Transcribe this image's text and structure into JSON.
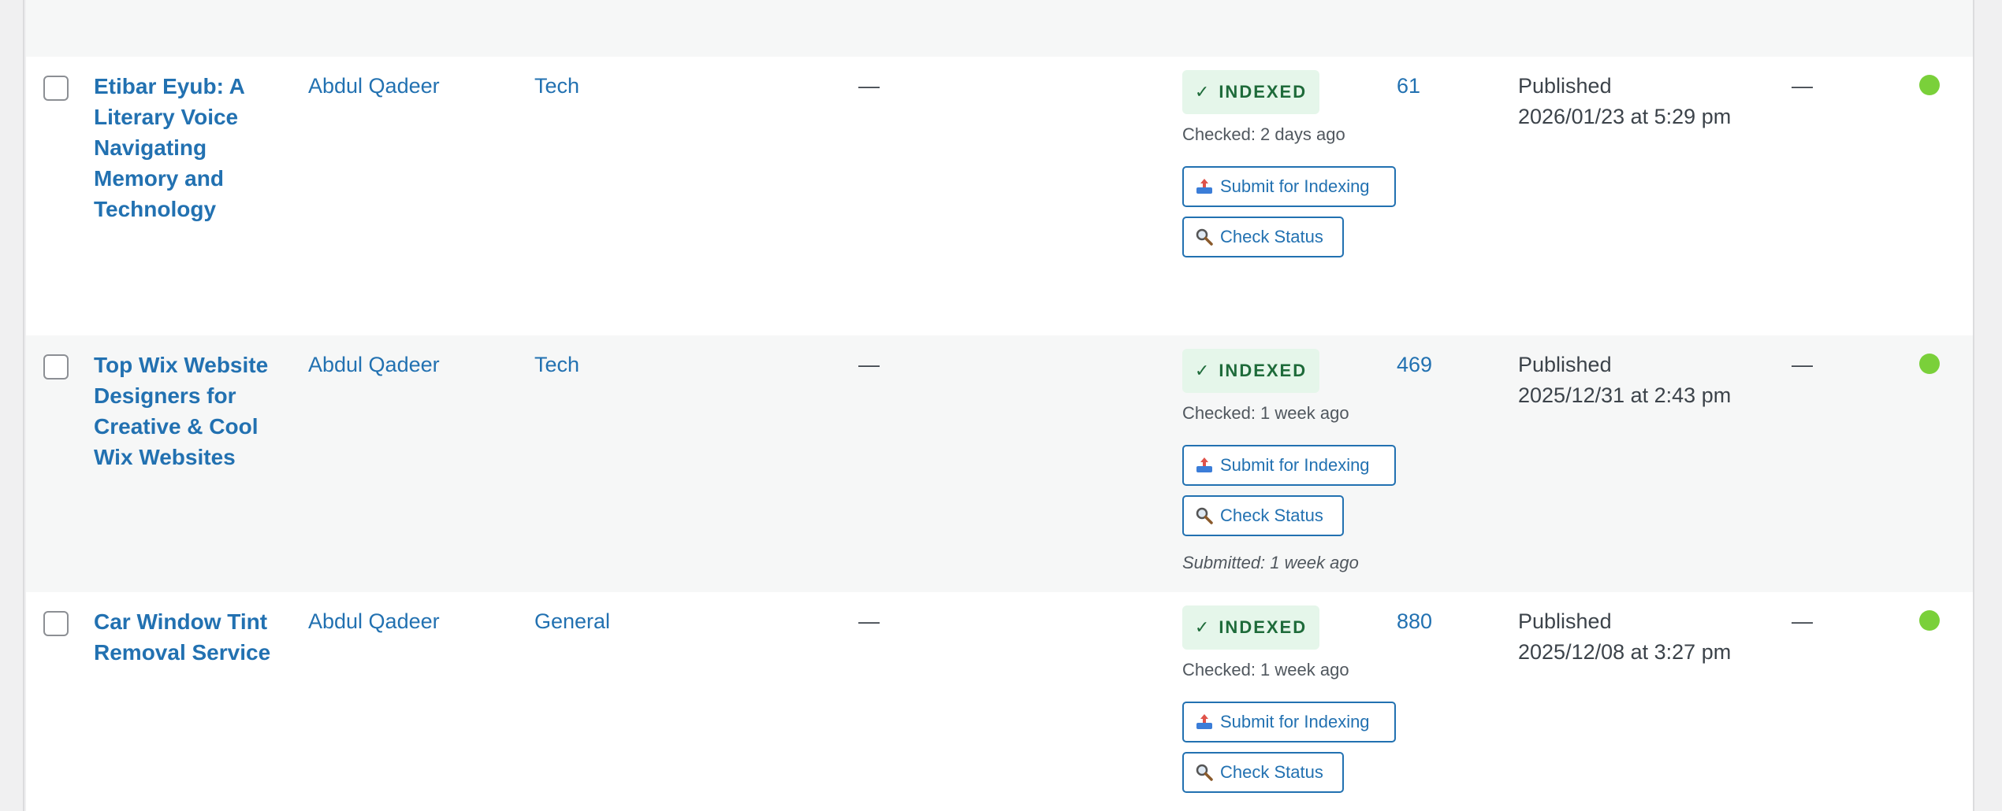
{
  "colors": {
    "link": "#2271b1",
    "badge_bg": "#e5f6ea",
    "badge_text": "#1e6b3a",
    "status_dot": "#7ad03a"
  },
  "icons": {
    "submit": "upload-tray-icon",
    "check": "magnifier-icon"
  },
  "rows": [
    {
      "title": "Etibar Eyub: A Literary Voice Navigating Memory and Technology",
      "author": "Abdul Qadeer",
      "category": "Tech",
      "tags": "—",
      "index_status": "INDEXED",
      "checked": "Checked: 2 days ago",
      "submit_label": "Submit for Indexing",
      "check_label": "Check Status",
      "submitted": "",
      "count": "61",
      "date_status": "Published",
      "date": "2026/01/23 at 5:29 pm",
      "extra": "—"
    },
    {
      "title": "Top Wix Website Designers for Creative & Cool Wix Websites",
      "author": "Abdul Qadeer",
      "category": "Tech",
      "tags": "—",
      "index_status": "INDEXED",
      "checked": "Checked: 1 week ago",
      "submit_label": "Submit for Indexing",
      "check_label": "Check Status",
      "submitted": "Submitted: 1 week ago",
      "count": "469",
      "date_status": "Published",
      "date": "2025/12/31 at 2:43 pm",
      "extra": "—"
    },
    {
      "title": "Car Window Tint Removal Service",
      "author": "Abdul Qadeer",
      "category": "General",
      "tags": "—",
      "index_status": "INDEXED",
      "checked": "Checked: 1 week ago",
      "submit_label": "Submit for Indexing",
      "check_label": "Check Status",
      "submitted": "",
      "count": "880",
      "date_status": "Published",
      "date": "2025/12/08 at 3:27 pm",
      "extra": "—"
    }
  ]
}
